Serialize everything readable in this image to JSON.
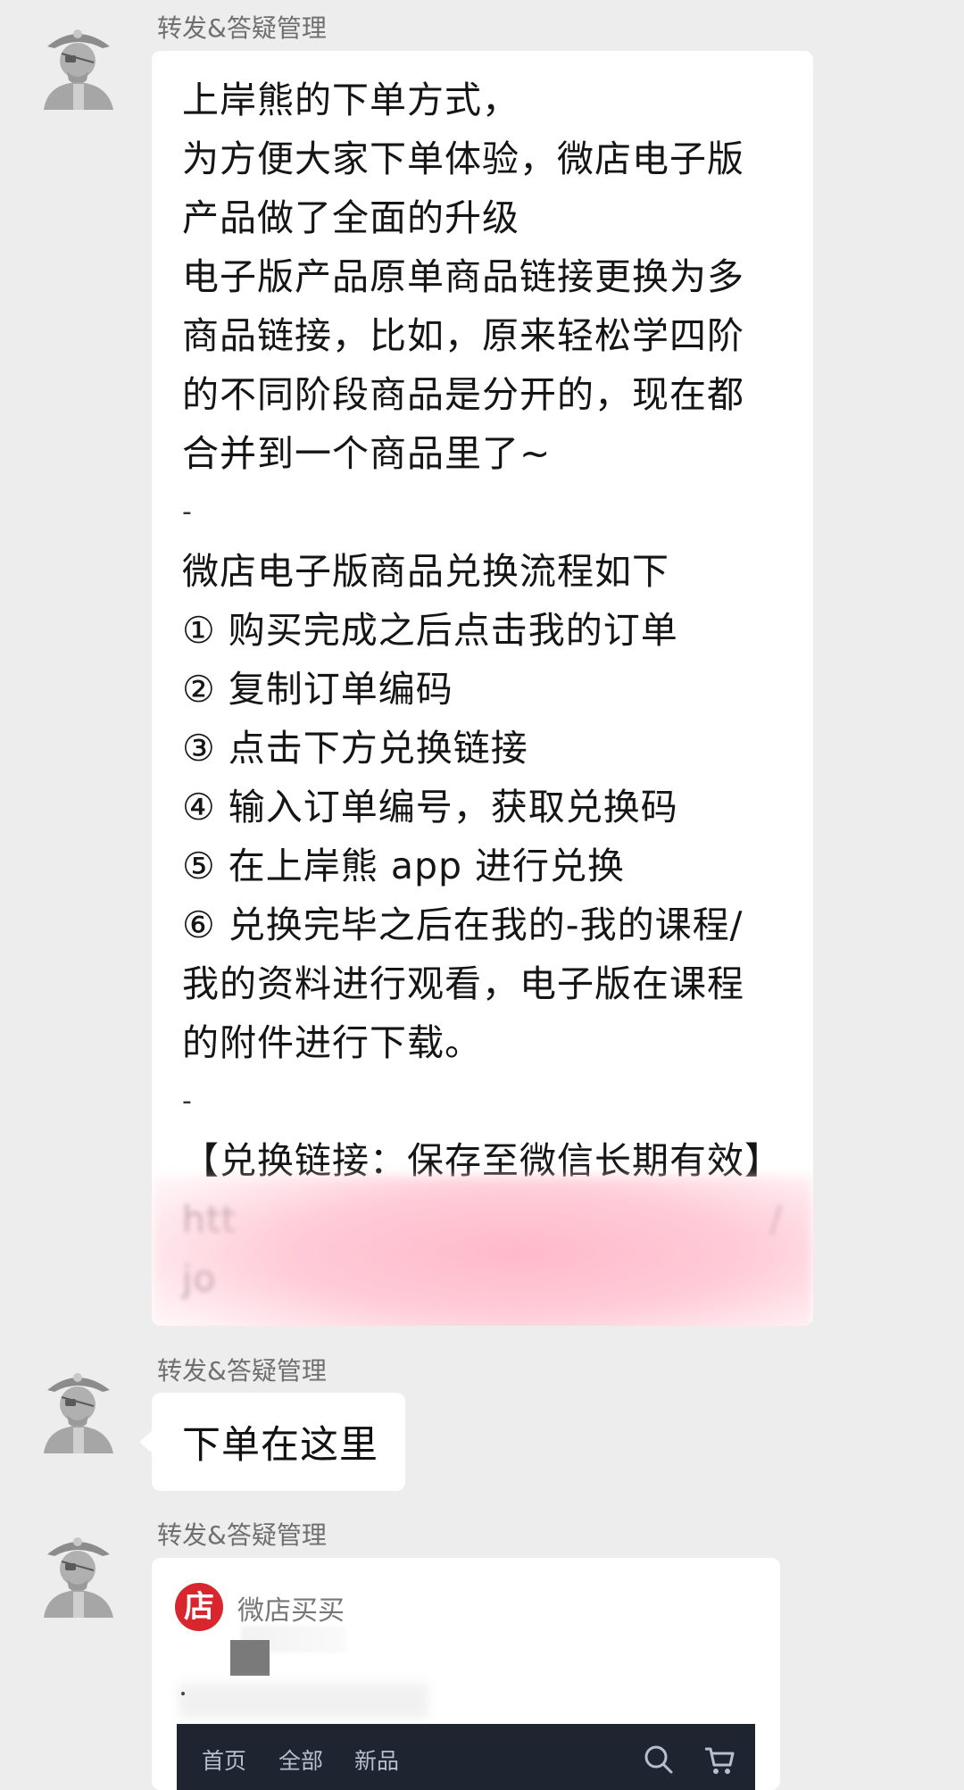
{
  "messages": [
    {
      "sender": "转发&答疑管理",
      "lines": [
        "上岸熊的下单方式，",
        "为方便大家下单体验，微店电子版",
        "产品做了全面的升级",
        "电子版产品原单商品链接更换为多",
        "商品链接，比如，原来轻松学四阶",
        "的不同阶段商品是分开的，现在都",
        "合并到一个商品里了~",
        "-",
        "微店电子版商品兑换流程如下",
        "① 购买完成之后点击我的订单",
        "② 复制订单编码",
        "③ 点击下方兑换链接",
        "④ 输入订单编号，获取兑换码",
        "⑤ 在上岸熊 app 进行兑换",
        "⑥ 兑换完毕之后在我的-我的课程/",
        "我的资料进行观看，电子版在课程",
        "的附件进行下载。",
        "-",
        "【兑换链接：保存至微信长期有效】"
      ],
      "link_fragments": [
        "htt",
        "/",
        "jo"
      ]
    },
    {
      "sender": "转发&答疑管理",
      "text": "下单在这里"
    },
    {
      "sender": "转发&答疑管理",
      "card": {
        "logo_char": "店",
        "shop_name": "微店买买",
        "nav": [
          "首页",
          "全部",
          "新品"
        ],
        "icons": [
          "search-icon",
          "cart-icon"
        ]
      }
    }
  ],
  "colors": {
    "background": "#ededed",
    "bubble": "#ffffff",
    "sender_text": "#6f6f6f",
    "shop_logo": "#d8262f",
    "preview_bar": "#1e2430",
    "blur_overlay": "#ffc4d2"
  }
}
